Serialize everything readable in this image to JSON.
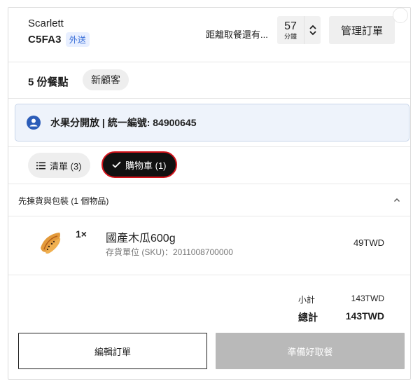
{
  "header": {
    "customer_name": "Scarlett",
    "order_code": "C5FA3",
    "delivery_badge": "外送",
    "pickup_label": "距離取餐還有...",
    "minutes_value": "57",
    "minutes_unit": "分鐘",
    "manage_button": "管理訂單"
  },
  "customer": {
    "items_count": "5 份餐點",
    "new_customer": "新顧客"
  },
  "banner": {
    "text": "水果分開放 | 統一編號: 84900645"
  },
  "tabs": [
    {
      "label": "清單 (3)",
      "selected": false
    },
    {
      "label": "購物車 (1)",
      "selected": true
    }
  ],
  "section": {
    "title": "先揀貨與包裝 (1 個物品)"
  },
  "items": [
    {
      "qty": "1×",
      "name": "國產木瓜600g",
      "sku": "存貨單位 (SKU)：2011008700000",
      "price": "49TWD"
    }
  ],
  "totals": {
    "subtotal_label": "小計",
    "subtotal_value": "143TWD",
    "total_label": "總計",
    "total_value": "143TWD"
  },
  "actions": {
    "edit": "編輯訂單",
    "ready": "準備好取餐"
  },
  "colors": {
    "accent_red": "#d4131b",
    "banner_bg": "#eef3fb",
    "delivery_blue": "#3a6fd8",
    "disabled_gray": "#b9b9b9"
  }
}
